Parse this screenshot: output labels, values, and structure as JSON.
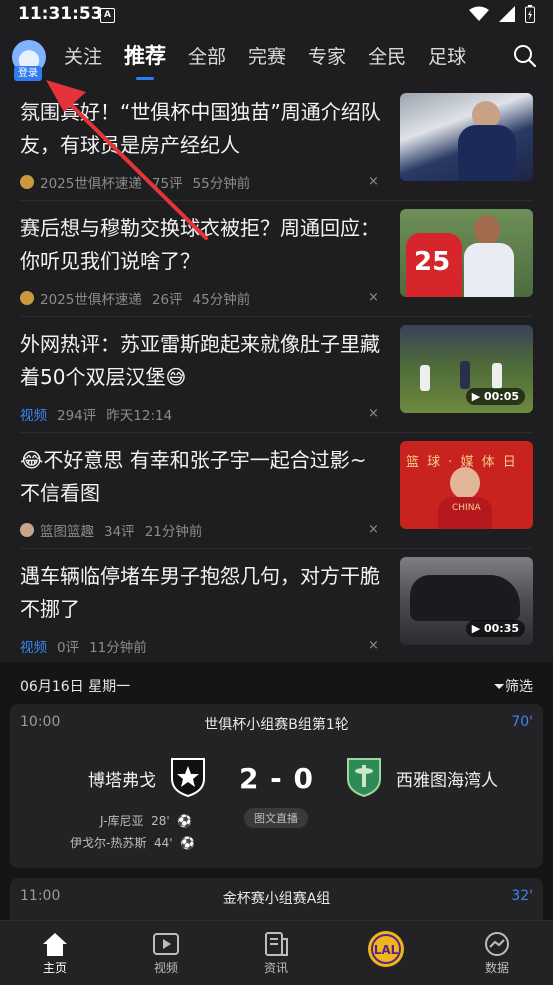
{
  "status_bar": {
    "time": "11:31:53",
    "a_icon": "A"
  },
  "top_nav": {
    "login": "登录",
    "tabs": [
      "关注",
      "推荐",
      "全部",
      "完赛",
      "专家",
      "全民",
      "足球"
    ],
    "active_tab": "推荐"
  },
  "news": [
    {
      "title": "氛围真好！“世俱杯中国独苗”周通介绍队友，有球员是房产经纪人",
      "source": "2025世俱杯速递",
      "comments": "75评",
      "time": "55分钟前",
      "close": "×"
    },
    {
      "title": "赛后想与穆勒交换球衣被拒？周通回应：你听见我们说啥了？",
      "source": "2025世俱杯速递",
      "comments": "26评",
      "time": "45分钟前",
      "close": "×"
    },
    {
      "title": "外网热评：苏亚雷斯跑起来就像肚子里藏着50个双层汉堡😅",
      "tag": "视频",
      "comments": "294评",
      "time": "昨天12:14",
      "duration": "00:05",
      "close": "×"
    },
    {
      "title": "😂不好意思 有幸和张子宇一起合过影~不信看图",
      "source": "篮图篮趣",
      "comments": "34评",
      "time": "21分钟前",
      "close": "×"
    },
    {
      "title": "遇车辆临停堵车男子抱怨几句，对方干脆不挪了",
      "tag": "视频",
      "comments": "0评",
      "time": "11分钟前",
      "duration": "00:35",
      "close": "×"
    }
  ],
  "thumbs": {
    "caption2": "25",
    "caption4": "篮 球 ·  媒 体 日",
    "caption4b": "CHINA"
  },
  "schedule": {
    "date": "06月16日 星期一",
    "filter": "筛选"
  },
  "match1": {
    "time": "10:00",
    "league": "世俱杯小组赛B组第1轮",
    "minute": "70'",
    "home": "博塔弗戈",
    "away": "西雅图海湾人",
    "score": "2 - 0",
    "live": "图文直播",
    "scorers": [
      {
        "name": "J-库尼亚",
        "min": "28'"
      },
      {
        "name": "伊戈尔-热苏斯",
        "min": "44'"
      }
    ]
  },
  "match2": {
    "time": "11:00",
    "league": "金杯赛小组赛A组",
    "minute": "32'"
  },
  "bottom_nav": [
    {
      "label": "主页",
      "icon": "home-icon"
    },
    {
      "label": "视频",
      "icon": "video-icon"
    },
    {
      "label": "资讯",
      "icon": "news-icon"
    },
    {
      "label": "",
      "icon": "lal-logo-icon",
      "logo_text": "LAL"
    },
    {
      "label": "数据",
      "icon": "data-icon"
    }
  ],
  "colors": {
    "accent": "#2f7cf0",
    "arrow": "#e5333b",
    "background": "#1e1e20"
  }
}
